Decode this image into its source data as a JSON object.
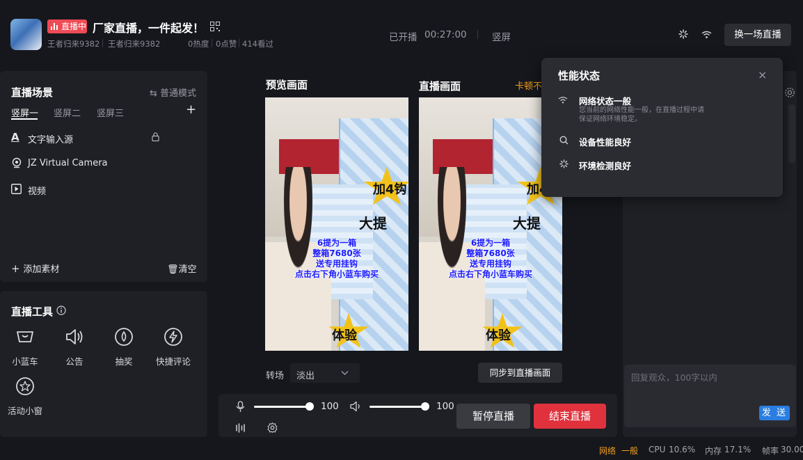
{
  "header": {
    "live_badge": "直播中",
    "title": "厂家直播，一件起发！",
    "account1": "王者归来9382",
    "account2": "王者归来9382",
    "heat": "0热度",
    "likes": "0点赞",
    "views": "414看过",
    "status_started": "已开播",
    "timer": "00:27:00",
    "orientation": "竖屏",
    "switch_button": "换一场直播"
  },
  "scene": {
    "title": "直播场景",
    "mode": "普通模式",
    "tabs": [
      "竖屏一",
      "竖屏二",
      "竖屏三"
    ],
    "sources": [
      "文字输入源",
      "JZ Virtual Camera",
      "视频"
    ],
    "add_material": "添加素材",
    "clear": "清空"
  },
  "tools": {
    "title": "直播工具",
    "items": [
      "小蓝车",
      "公告",
      "抽奖",
      "快捷评论",
      "活动小窗"
    ]
  },
  "center": {
    "preview_title": "预览画面",
    "live_title": "直播画面",
    "lag_hint": "卡顿不",
    "overlay_lines": [
      "6提为一箱",
      "整箱7680张",
      "送专用挂钩",
      "点击右下角小蓝车购买"
    ],
    "sticker_add": "加4钩",
    "sticker_big": "大提",
    "sticker_exp": "体验",
    "transition_label": "转场",
    "transition_value": "淡出",
    "sync_button": "同步到直播画面",
    "mic_volume": "100",
    "speaker_volume": "100",
    "pause_button": "暂停直播",
    "end_button": "结束直播"
  },
  "comment": {
    "placeholder": "回复观众，100字以内",
    "send": "发 送"
  },
  "popup": {
    "title": "性能状态",
    "network_title": "网络状态一般",
    "network_desc": "您当前的网络性能一般，在直播过程中请保证网络环境稳定。",
    "device": "设备性能良好",
    "environment": "环境检测良好"
  },
  "status": {
    "network_label": "网络",
    "network_value": "一般",
    "cpu_label": "CPU",
    "cpu_value": "10.6%",
    "mem_label": "内存",
    "mem_value": "17.1%",
    "fps_label": "帧率",
    "fps_value": "30.00"
  },
  "colors": {
    "accent_red": "#e0323d",
    "accent_blue": "#2a7de1",
    "warning_orange": "#f0a020"
  }
}
